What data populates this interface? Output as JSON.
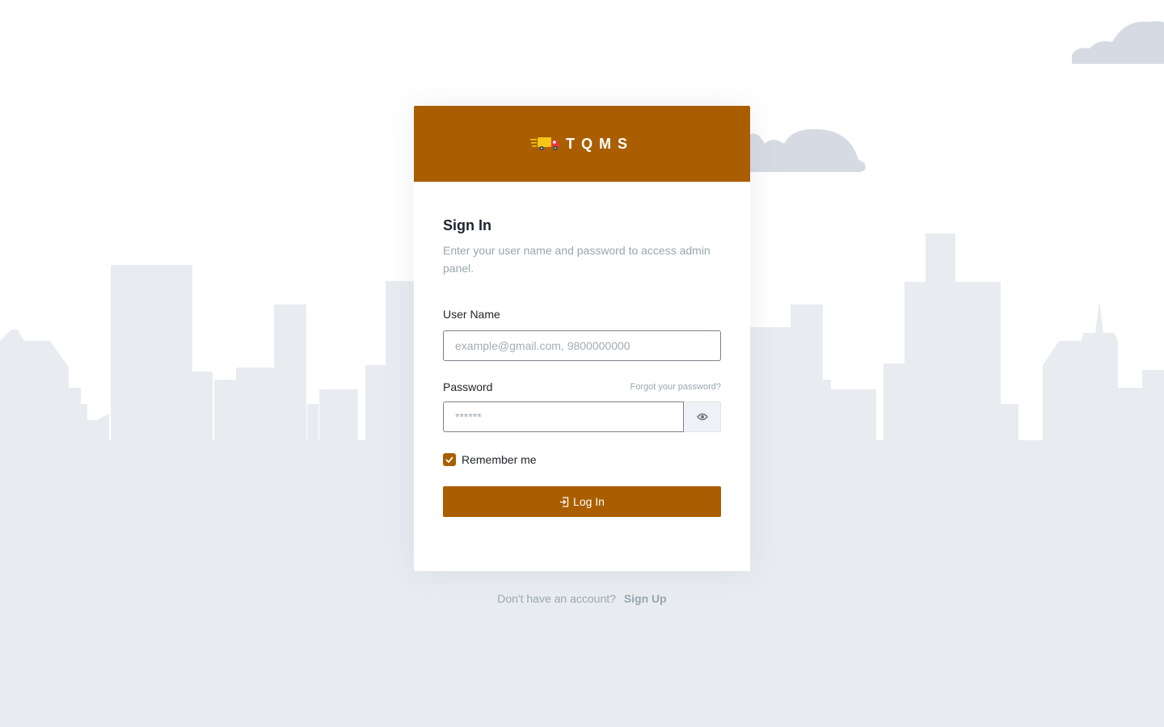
{
  "brand": {
    "name": "TQMS",
    "accent": "#aa5e01"
  },
  "signin": {
    "title": "Sign In",
    "subtitle": "Enter your user name and password to access admin panel."
  },
  "username": {
    "label": "User Name",
    "placeholder": "example@gmail.com, 9800000000",
    "value": ""
  },
  "password": {
    "label": "Password",
    "placeholder": "******",
    "value": "",
    "forgot_link": "Forgot your password?",
    "toggle_icon": "eye-icon"
  },
  "remember": {
    "label": "Remember me",
    "checked": true
  },
  "login_button": {
    "label": "Log In",
    "icon": "sign-in-icon"
  },
  "footer": {
    "text": "Don't have an account?",
    "signup_label": "Sign Up"
  }
}
